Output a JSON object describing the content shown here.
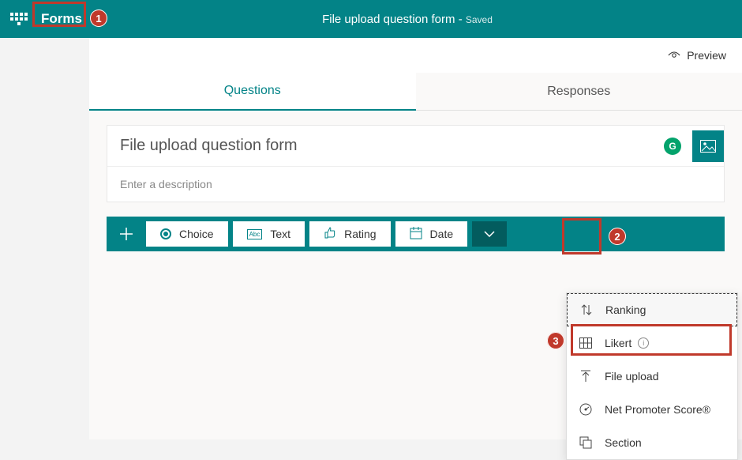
{
  "header": {
    "app_name": "Forms",
    "title": "File upload question form",
    "status": "Saved"
  },
  "command_bar": {
    "preview": "Preview"
  },
  "tabs": {
    "questions": "Questions",
    "responses": "Responses"
  },
  "form": {
    "title": "File upload question form",
    "description_placeholder": "Enter a description"
  },
  "question_types": {
    "choice": "Choice",
    "text": "Text",
    "rating": "Rating",
    "date": "Date"
  },
  "more_menu": {
    "ranking": "Ranking",
    "likert": "Likert",
    "file_upload": "File upload",
    "nps": "Net Promoter Score®",
    "section": "Section"
  },
  "annotations": {
    "one": "1",
    "two": "2",
    "three": "3"
  }
}
